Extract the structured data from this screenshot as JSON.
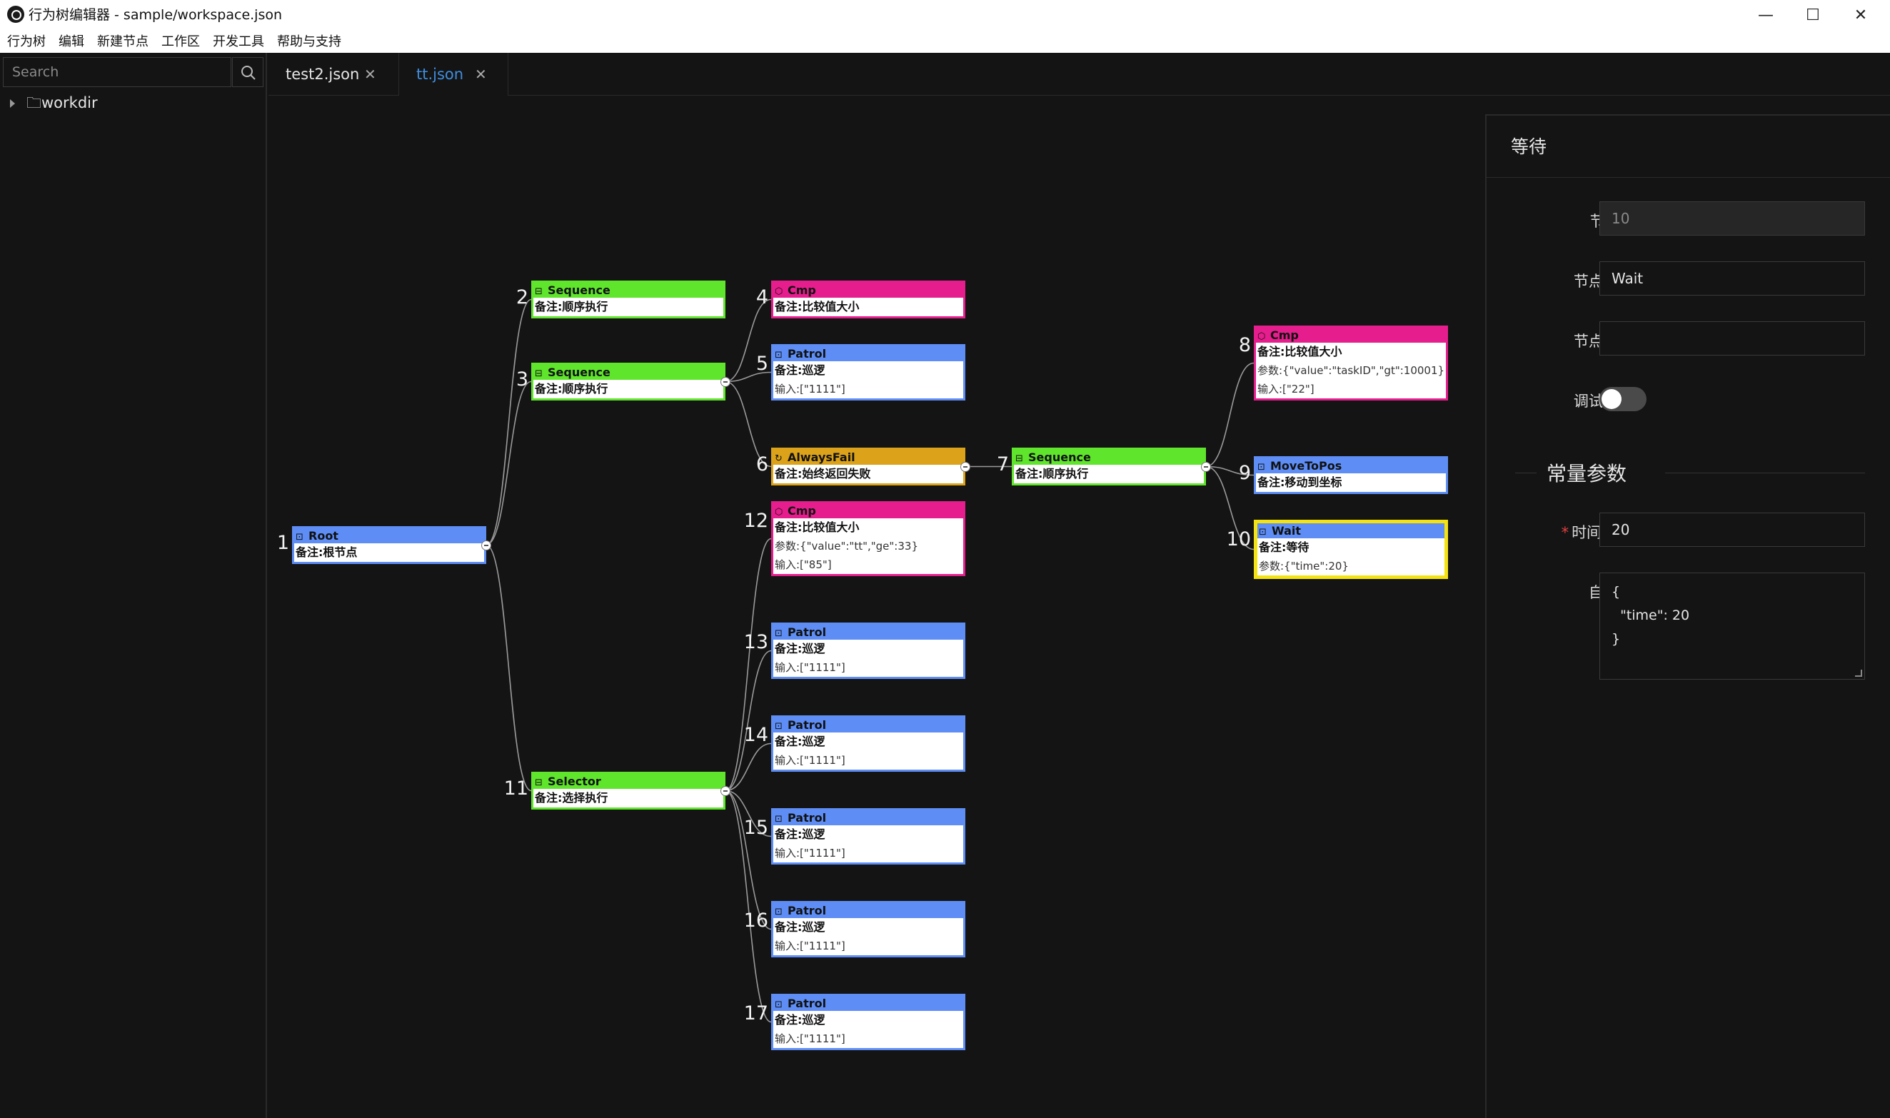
{
  "window": {
    "title": "行为树编辑器 - sample/workspace.json",
    "minimize_glyph": "—",
    "maximize_glyph": "☐",
    "close_glyph": "✕"
  },
  "menu": [
    "行为树",
    "编辑",
    "新建节点",
    "工作区",
    "开发工具",
    "帮助与支持"
  ],
  "sidebar": {
    "search_placeholder": "Search",
    "search_icon": "search-icon",
    "tree_root": "🗀workdir"
  },
  "tabs": [
    {
      "label": "test2.json",
      "active": false
    },
    {
      "label": "tt.json",
      "active": true
    }
  ],
  "tab_close_glyph": "✕",
  "tree": {
    "colors": {
      "blue": "#5e8ef5",
      "green": "#5fe52b",
      "pink": "#e61d8c",
      "orange": "#dba21a",
      "selected": "#f5e311"
    },
    "nodes": [
      {
        "id": "1",
        "name": "Root",
        "type": "action",
        "color": "blue",
        "lines": [
          "备注:根节点"
        ]
      },
      {
        "id": "2",
        "name": "Sequence",
        "type": "composite",
        "color": "green",
        "lines": [
          "备注:顺序执行"
        ]
      },
      {
        "id": "3",
        "name": "Sequence",
        "type": "composite",
        "color": "green",
        "lines": [
          "备注:顺序执行"
        ]
      },
      {
        "id": "4",
        "name": "Cmp",
        "type": "condition",
        "color": "pink",
        "lines": [
          "备注:比较值大小"
        ]
      },
      {
        "id": "5",
        "name": "Patrol",
        "type": "action",
        "color": "blue",
        "lines": [
          "备注:巡逻",
          "输入:[\"1111\"]"
        ]
      },
      {
        "id": "6",
        "name": "AlwaysFail",
        "type": "decorator",
        "color": "orange",
        "lines": [
          "备注:始终返回失败"
        ]
      },
      {
        "id": "7",
        "name": "Sequence",
        "type": "composite",
        "color": "green",
        "lines": [
          "备注:顺序执行"
        ]
      },
      {
        "id": "8",
        "name": "Cmp",
        "type": "condition",
        "color": "pink",
        "lines": [
          "备注:比较值大小",
          "参数:{\"value\":\"taskID\",\"gt\":10001}",
          "输入:[\"22\"]"
        ]
      },
      {
        "id": "9",
        "name": "MoveToPos",
        "type": "action",
        "color": "blue",
        "lines": [
          "备注:移动到坐标"
        ]
      },
      {
        "id": "10",
        "name": "Wait",
        "type": "action",
        "color": "blue",
        "selected": true,
        "lines": [
          "备注:等待",
          "参数:{\"time\":20}"
        ]
      },
      {
        "id": "11",
        "name": "Selector",
        "type": "composite",
        "color": "green",
        "lines": [
          "备注:选择执行"
        ]
      },
      {
        "id": "12",
        "name": "Cmp",
        "type": "condition",
        "color": "pink",
        "lines": [
          "备注:比较值大小",
          "参数:{\"value\":\"tt\",\"ge\":33}",
          "输入:[\"85\"]"
        ]
      },
      {
        "id": "13",
        "name": "Patrol",
        "type": "action",
        "color": "blue",
        "lines": [
          "备注:巡逻",
          "输入:[\"1111\"]"
        ]
      },
      {
        "id": "14",
        "name": "Patrol",
        "type": "action",
        "color": "blue",
        "lines": [
          "备注:巡逻",
          "输入:[\"1111\"]"
        ]
      },
      {
        "id": "15",
        "name": "Patrol",
        "type": "action",
        "color": "blue",
        "lines": [
          "备注:巡逻",
          "输入:[\"1111\"]"
        ]
      },
      {
        "id": "16",
        "name": "Patrol",
        "type": "action",
        "color": "blue",
        "lines": [
          "备注:巡逻",
          "输入:[\"1111\"]"
        ]
      },
      {
        "id": "17",
        "name": "Patrol",
        "type": "action",
        "color": "blue",
        "lines": [
          "备注:巡逻",
          "输入:[\"1111\"]"
        ]
      }
    ]
  },
  "panel": {
    "title": "等待",
    "fields": {
      "node_id_label": "节点id:",
      "node_id_value": "10",
      "node_name_label": "节点名称:",
      "node_name_value": "Wait",
      "node_desc_label": "节点说明:",
      "node_desc_value": "",
      "debug_label": "调试开关:",
      "debug_on": false
    },
    "const_heading": "常量参数",
    "time_label": "时间/tick:",
    "time_required_mark": "*",
    "time_value": "20",
    "custom_label": "自定义:",
    "custom_value": "{\n  \"time\": 20\n}"
  }
}
